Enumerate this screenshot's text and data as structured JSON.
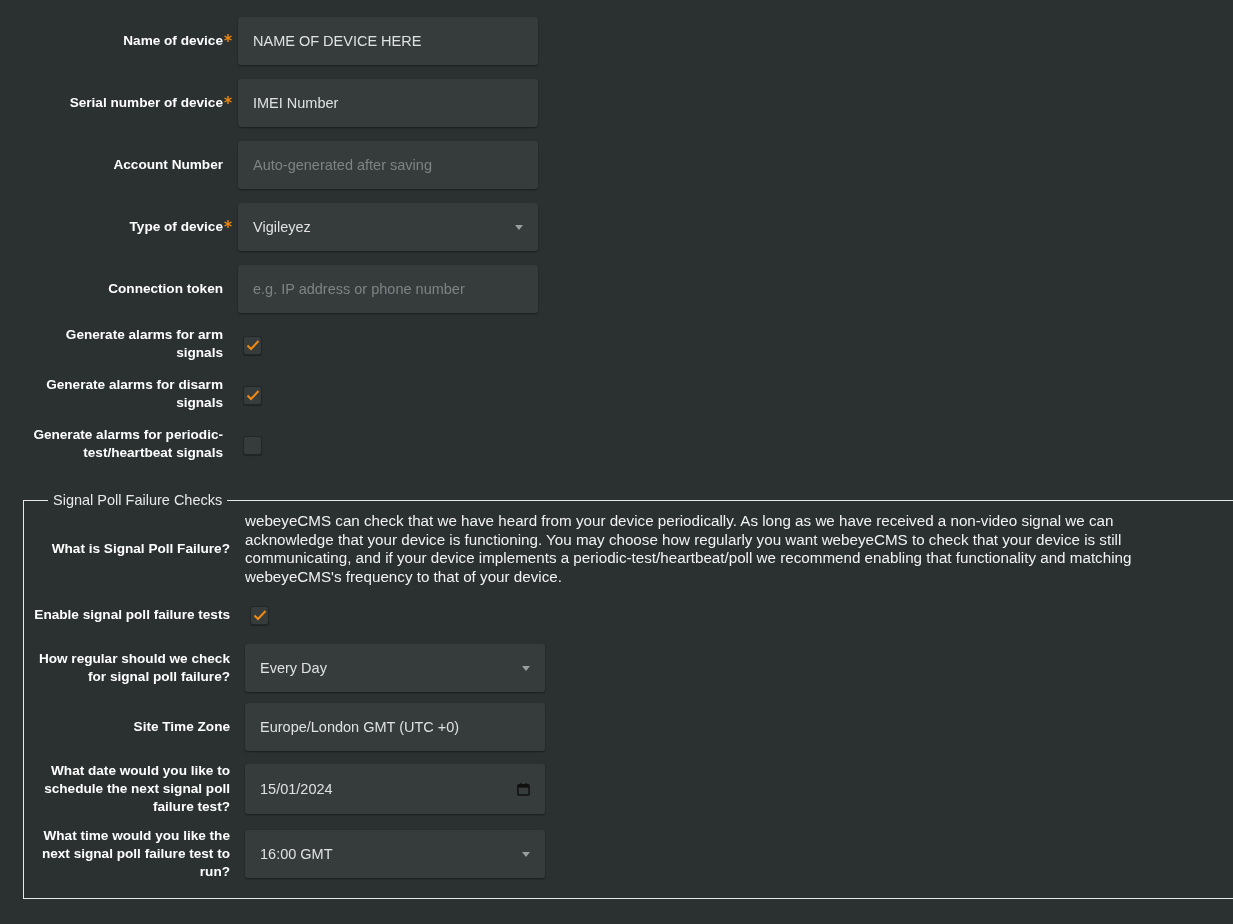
{
  "fields": [
    {
      "label": "Name of device",
      "required": true,
      "kind": "text",
      "value": "NAME OF DEVICE HERE"
    },
    {
      "label": "Serial number of device",
      "required": true,
      "kind": "text",
      "value": "IMEI Number"
    },
    {
      "label": "Account Number",
      "required": false,
      "kind": "text",
      "placeholder": "Auto-generated after saving"
    },
    {
      "label": "Type of device",
      "required": true,
      "kind": "select",
      "value": "Vigileyez"
    },
    {
      "label": "Connection token",
      "required": false,
      "kind": "text",
      "placeholder": "e.g. IP address or phone number"
    },
    {
      "label": "Generate alarms for arm signals",
      "required": false,
      "kind": "checkbox",
      "checked": true
    },
    {
      "label": "Generate alarms for disarm signals",
      "required": false,
      "kind": "checkbox",
      "checked": true
    },
    {
      "label": "Generate alarms for periodic-test/heartbeat signals",
      "required": false,
      "kind": "checkbox",
      "checked": false
    }
  ],
  "signal_poll": {
    "legend": "Signal Poll Failure Checks",
    "rows": [
      {
        "label": "What is Signal Poll Failure?",
        "required": false,
        "kind": "info",
        "text": "webeyeCMS can check that we have heard from your device periodically. As long as we have received a non-video signal we can acknowledge that your device is functioning. You may choose how regularly you want webeyeCMS to check that your device is still communicating, and if your device implements a periodic-test/heartbeat/poll we recommend enabling that functionality and matching webeyeCMS's frequency to that of your device."
      },
      {
        "label": "Enable signal poll failure tests",
        "required": false,
        "kind": "checkbox",
        "checked": true
      },
      {
        "label": "How regular should we check for signal poll failure?",
        "required": false,
        "kind": "select",
        "value": "Every Day"
      },
      {
        "label": "Site Time Zone",
        "required": false,
        "kind": "text",
        "value": "Europe/London GMT (UTC +0)"
      },
      {
        "label": "What date would you like to schedule the next signal poll failure test?",
        "required": false,
        "kind": "date",
        "value": "15/01/2024"
      },
      {
        "label": "What time would you like the next signal poll failure test to run?",
        "required": false,
        "kind": "select",
        "value": "16:00 GMT"
      }
    ]
  }
}
